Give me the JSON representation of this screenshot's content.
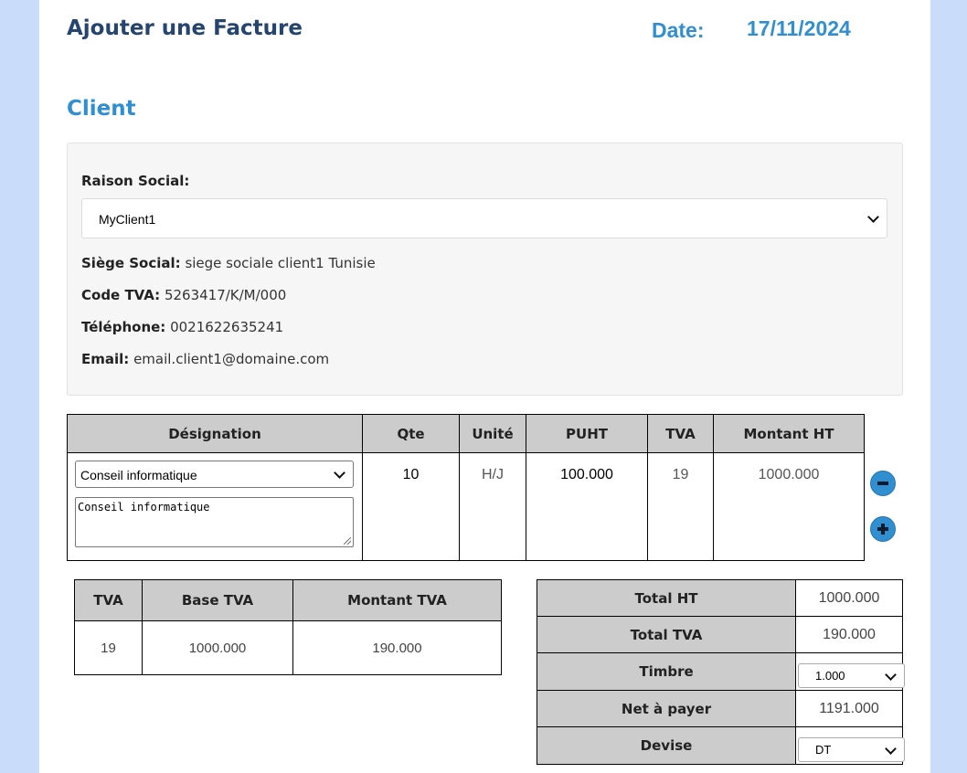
{
  "header": {
    "title": "Ajouter une Facture",
    "date_label": "Date:",
    "date_value": "17/11/2024"
  },
  "client": {
    "section_title": "Client",
    "raison_label": "Raison Social:",
    "raison_value": "MyClient1",
    "siege_label": "Siège Social:",
    "siege_value": "siege sociale client1 Tunisie",
    "tva_label": "Code TVA:",
    "tva_value": "5263417/K/M/000",
    "tel_label": "Téléphone:",
    "tel_value": "0021622635241",
    "email_label": "Email:",
    "email_value": "email.client1@domaine.com"
  },
  "items_table": {
    "headers": [
      "Désignation",
      "Qte",
      "Unité",
      "PUHT",
      "TVA",
      "Montant HT"
    ],
    "rows": [
      {
        "product": "Conseil informatique",
        "description": "Conseil informatique",
        "qte": "10",
        "unite": "H/J",
        "puht": "100.000",
        "tva": "19",
        "montant_ht": "1000.000"
      }
    ],
    "remove_icon": "minus-circle-icon",
    "add_icon": "plus-circle-icon"
  },
  "vat_table": {
    "headers": [
      "TVA",
      "Base TVA",
      "Montant TVA"
    ],
    "rows": [
      {
        "tva": "19",
        "base": "1000.000",
        "montant": "190.000"
      }
    ]
  },
  "totals": {
    "total_ht_label": "Total HT",
    "total_ht_value": "1000.000",
    "total_tva_label": "Total TVA",
    "total_tva_value": "190.000",
    "timbre_label": "Timbre",
    "timbre_value": "1.000",
    "net_label": "Net à payer",
    "net_value": "1191.000",
    "devise_label": "Devise",
    "devise_value": "DT"
  },
  "colors": {
    "background": "#c9ddfb",
    "title": "#25456e",
    "accent": "#2f8fd0",
    "table_header": "#cccccc"
  }
}
